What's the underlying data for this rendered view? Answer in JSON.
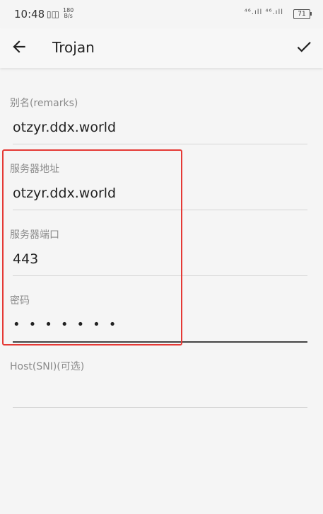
{
  "status_bar": {
    "time": "10:48",
    "net_speed_value": "180",
    "net_speed_unit": "B/s",
    "signal_1": "⁴⁶.ıll",
    "signal_2": "⁴⁶.ıll",
    "battery": "71"
  },
  "app_bar": {
    "title": "Trojan",
    "back_icon": "arrow-left-icon",
    "confirm_icon": "check-icon"
  },
  "form": {
    "remarks": {
      "label": "别名(remarks)",
      "value": "otzyr.ddx.world"
    },
    "server_address": {
      "label": "服务器地址",
      "value": "otzyr.ddx.world"
    },
    "server_port": {
      "label": "服务器端口",
      "value": "443"
    },
    "password": {
      "label": "密码",
      "value": "•••••••"
    },
    "host_sni": {
      "label": "Host(SNI)(可选)",
      "value": ""
    }
  },
  "highlight_color": "#e53935"
}
